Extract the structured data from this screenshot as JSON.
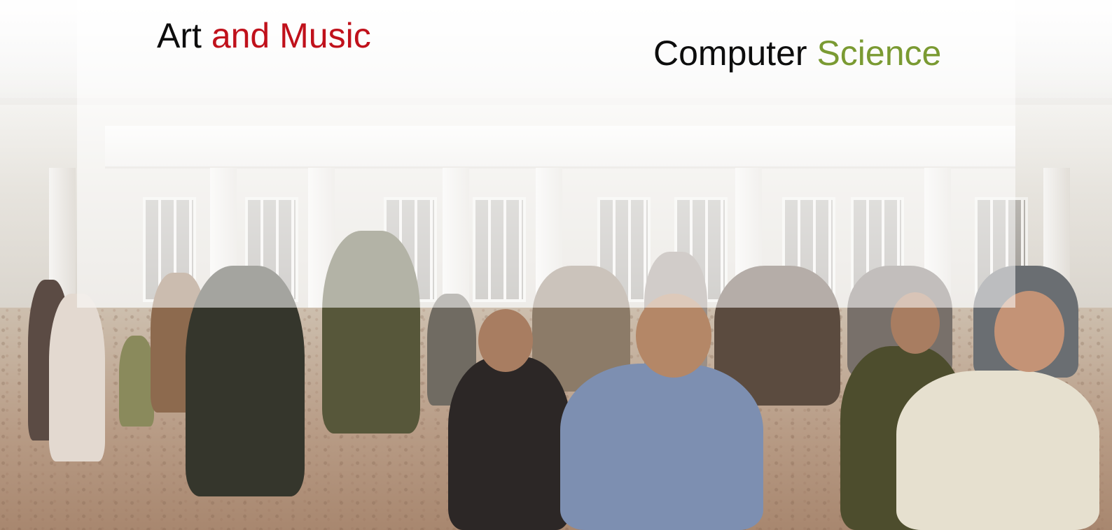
{
  "slide": {
    "left_title": {
      "word1": "Art",
      "word2": "and Music",
      "word1_color": "#0d0d0d",
      "word2_color": "#c0111b"
    },
    "right_title": {
      "word1": "Computer",
      "word2": "Science",
      "word1_color": "#0d0d0d",
      "word2_color": "#7a9a32"
    }
  }
}
